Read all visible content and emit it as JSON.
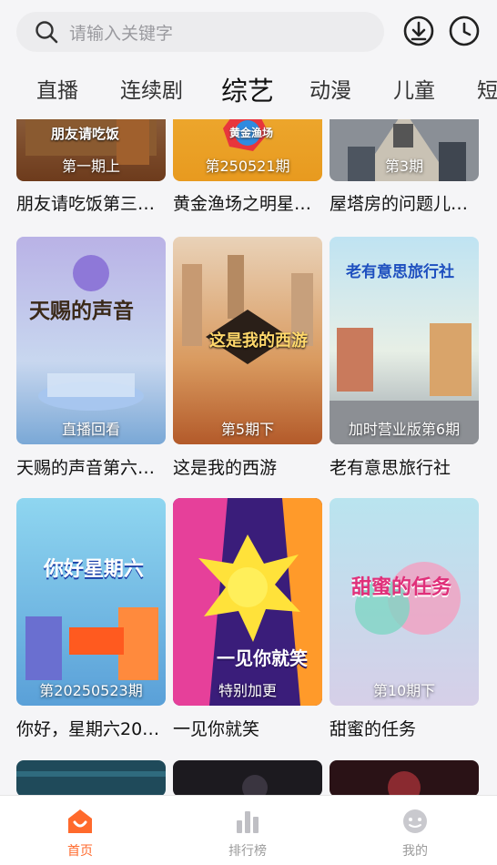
{
  "search": {
    "placeholder": "请输入关键字"
  },
  "toolbar": {
    "download_icon": "download-icon",
    "history_icon": "history-clock-icon"
  },
  "tabs": [
    {
      "label": "直播",
      "active": false
    },
    {
      "label": "连续剧",
      "active": false
    },
    {
      "label": "综艺",
      "active": true
    },
    {
      "label": "动漫",
      "active": false
    },
    {
      "label": "儿童",
      "active": false
    },
    {
      "label": "短",
      "active": false
    }
  ],
  "grid": {
    "rows": [
      [
        {
          "title": "朋友请吃饭第三…",
          "episode": "第一期上",
          "poster_text": "朋友请吃饭"
        },
        {
          "title": "黄金渔场之明星…",
          "episode": "第250521期",
          "poster_text": "黄金渔场"
        },
        {
          "title": "屋塔房的问题儿…",
          "episode": "第3期",
          "poster_text": ""
        }
      ],
      [
        {
          "title": "天赐的声音第六…",
          "episode": "直播回看",
          "poster_text": "天赐的声音"
        },
        {
          "title": "这是我的西游",
          "episode": "第5期下",
          "poster_text": "这是我的西游"
        },
        {
          "title": "老有意思旅行社",
          "episode": "加时营业版第6期",
          "poster_text": "老有意思旅行社"
        }
      ],
      [
        {
          "title": "你好，星期六20…",
          "episode": "第20250523期",
          "poster_text": "你好星期六"
        },
        {
          "title": "一见你就笑",
          "episode": "特别加更",
          "poster_text": "一见你就笑"
        },
        {
          "title": "甜蜜的任务",
          "episode": "第10期下",
          "poster_text": "甜蜜的任务"
        }
      ]
    ]
  },
  "bottom_nav": [
    {
      "label": "首页",
      "icon": "home-icon",
      "active": true
    },
    {
      "label": "排行榜",
      "icon": "ranking-icon",
      "active": false
    },
    {
      "label": "我的",
      "icon": "profile-icon",
      "active": false
    }
  ],
  "colors": {
    "accent": "#ff6a2c",
    "nav_inactive": "#9b9b9b"
  }
}
